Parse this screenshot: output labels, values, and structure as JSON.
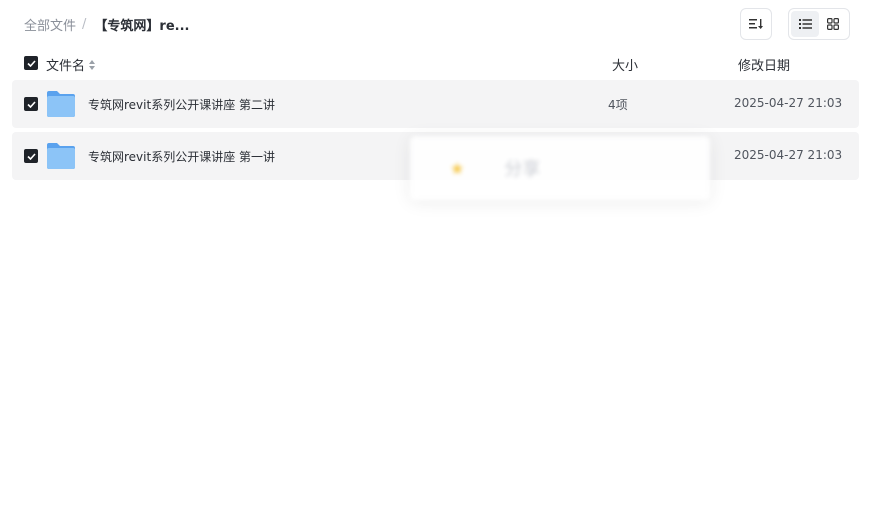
{
  "breadcrumb": {
    "root": "全部文件",
    "separator": "/",
    "current": "【专筑网】re..."
  },
  "toolbar": {
    "sort_icon": "sort-list-icon",
    "view_modes": [
      {
        "icon": "list-view-icon",
        "active": true
      },
      {
        "icon": "grid-view-icon",
        "active": false
      }
    ]
  },
  "header": {
    "name": "文件名",
    "size": "大小",
    "date": "修改日期"
  },
  "files": [
    {
      "name": "专筑网revit系列公开课讲座 第二讲",
      "size": "4项",
      "date": "2025-04-27 21:03",
      "checked": true,
      "icon": "folder-icon"
    },
    {
      "name": "专筑网revit系列公开课讲座 第一讲",
      "size": "",
      "date": "2025-04-27 21:03",
      "checked": true,
      "icon": "folder-icon"
    }
  ],
  "overlay_toast": {
    "text": "分享"
  },
  "colors": {
    "folder": "#6fb1f3",
    "row_bg": "#f4f4f5",
    "checkbox": "#1f2329"
  }
}
